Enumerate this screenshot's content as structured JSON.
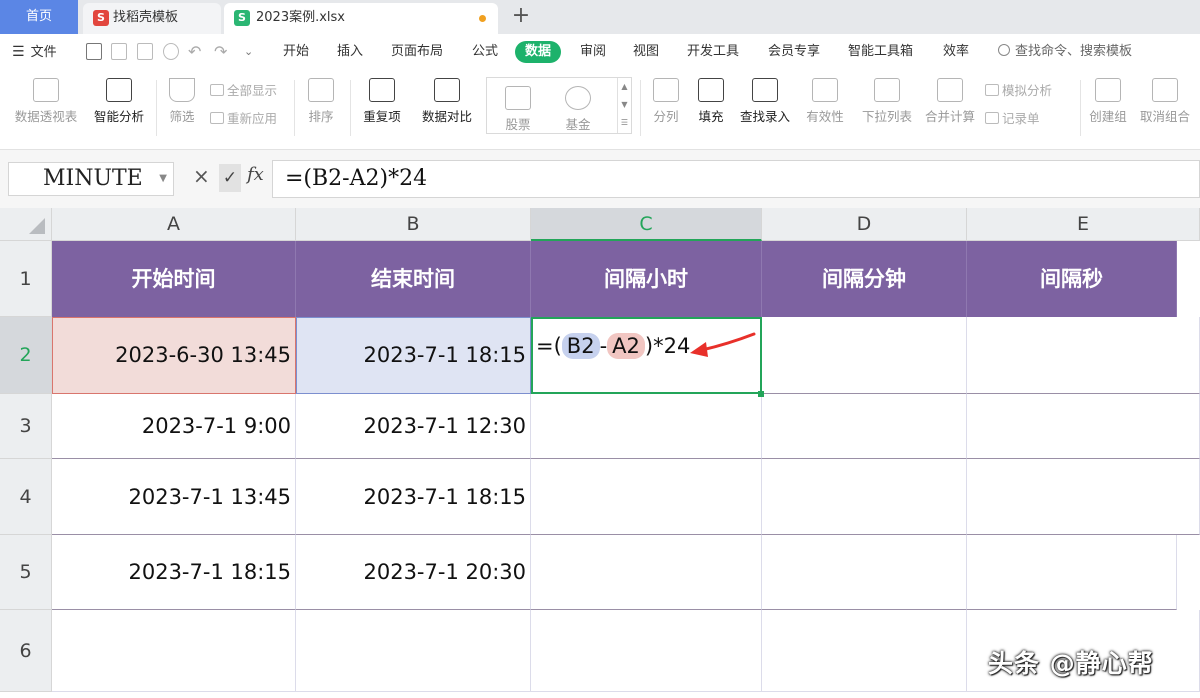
{
  "tabs": {
    "home": "首页",
    "template": "找稻壳模板",
    "file": "2023案例.xlsx",
    "new_tab": "+"
  },
  "menu": {
    "file": "文件",
    "items": [
      "开始",
      "插入",
      "页面布局",
      "公式",
      "数据",
      "审阅",
      "视图",
      "开发工具",
      "会员专享",
      "智能工具箱",
      "效率"
    ],
    "active": "数据",
    "search_placeholder": "查找命令、搜索模板"
  },
  "ribbon": {
    "pivot": "数据透视表",
    "smart_analysis": "智能分析",
    "filter": "筛选",
    "show_all": "全部显示",
    "reapply": "重新应用",
    "sort": "排序",
    "duplicates": "重复项",
    "compare": "数据对比",
    "stock": "股票",
    "fund": "基金",
    "split": "分列",
    "fill": "填充",
    "lookup_entry": "查找录入",
    "validity": "有效性",
    "dropdown_list": "下拉列表",
    "consolidate": "合并计算",
    "whatif": "模拟分析",
    "record_form": "记录单",
    "group": "创建组",
    "ungroup": "取消组合"
  },
  "formula_bar": {
    "name_box": "MINUTE",
    "cancel": "×",
    "confirm": "✓",
    "fx": "fx",
    "formula": "=(B2-A2)*24"
  },
  "sheet": {
    "columns": [
      "A",
      "B",
      "C",
      "D",
      "E"
    ],
    "rows": [
      "1",
      "2",
      "3",
      "4",
      "5",
      "6"
    ],
    "headers": [
      "开始时间",
      "结束时间",
      "间隔小时",
      "间隔分钟",
      "间隔秒"
    ],
    "data": [
      [
        "2023-6-30 13:45",
        "2023-7-1 18:15"
      ],
      [
        "2023-7-1 9:00",
        "2023-7-1 12:30"
      ],
      [
        "2023-7-1 13:45",
        "2023-7-1 18:15"
      ],
      [
        "2023-7-1 18:15",
        "2023-7-1 20:30"
      ]
    ],
    "edit_formula": {
      "prefix": "=(",
      "ref1": "B2",
      "minus": "-",
      "ref2": "A2",
      "suffix": ")*24"
    },
    "active_column": "C",
    "active_row": "2"
  },
  "colors": {
    "accent_green": "#1db26b",
    "header_purple": "#7d62a1",
    "ref_blue": "#c6d1ee",
    "ref_red": "#f1c6c2",
    "annotation_red": "#e8302a"
  },
  "watermark": "头条 @静心帮"
}
